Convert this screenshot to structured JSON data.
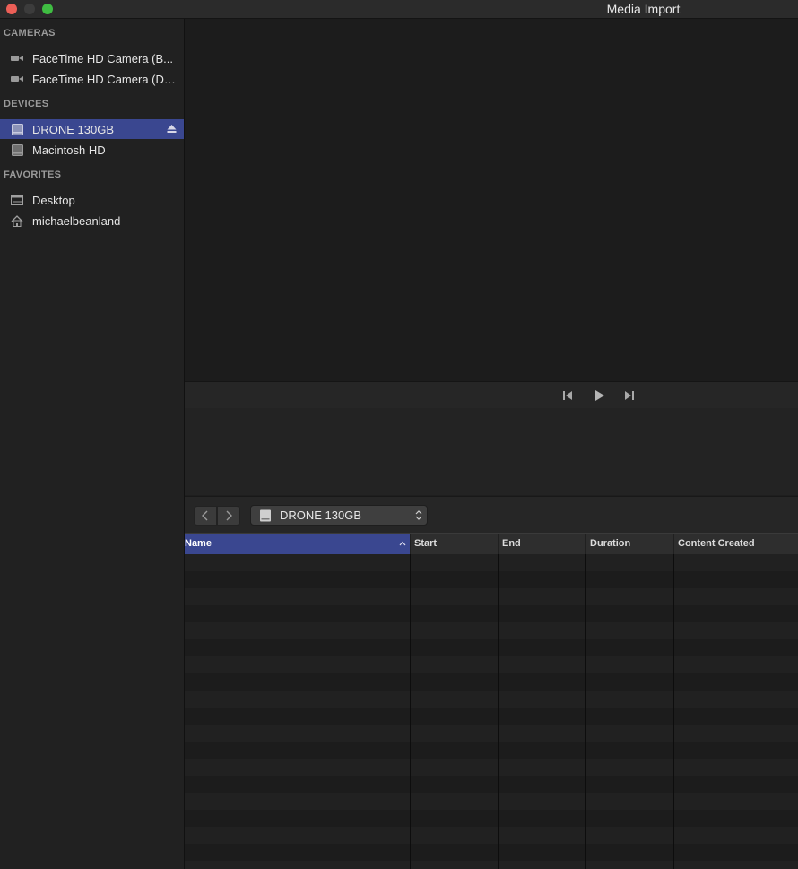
{
  "window": {
    "title": "Media Import"
  },
  "sidebar": {
    "sections": [
      {
        "header": "CAMERAS",
        "items": [
          {
            "label": "FaceTime HD Camera (B...",
            "icon": "camera-icon"
          },
          {
            "label": "FaceTime HD Camera (Di...",
            "icon": "camera-icon"
          }
        ]
      },
      {
        "header": "DEVICES",
        "items": [
          {
            "label": "DRONE 130GB",
            "icon": "drive-icon",
            "selected": true,
            "eject": true
          },
          {
            "label": "Macintosh HD",
            "icon": "drive-icon"
          }
        ]
      },
      {
        "header": "FAVORITES",
        "items": [
          {
            "label": "Desktop",
            "icon": "desktop-icon"
          },
          {
            "label": "michaelbeanland",
            "icon": "home-icon"
          }
        ]
      }
    ]
  },
  "browser": {
    "location": "DRONE 130GB",
    "columns": [
      "Name",
      "Start",
      "End",
      "Duration",
      "Content Created"
    ],
    "sort_column": "Name",
    "sort_direction": "ascending"
  },
  "colors": {
    "selection": "#3a4790",
    "close": "#ec5f57",
    "zoom": "#3fbd42"
  }
}
